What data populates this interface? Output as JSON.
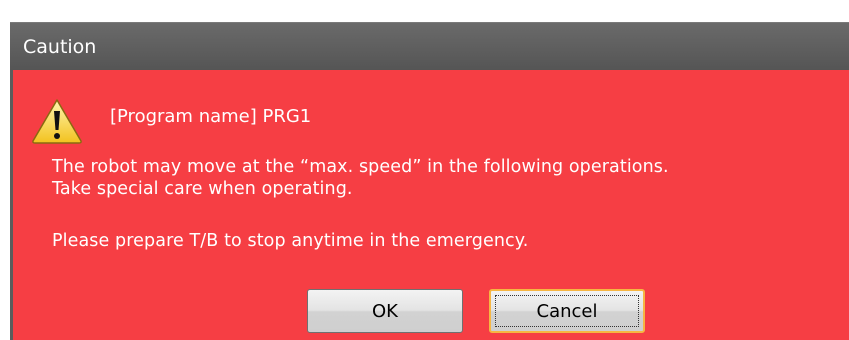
{
  "dialog": {
    "title": "Caution",
    "program_line": "[Program name] PRG1",
    "message_line_1": "The robot may move at the “max. speed” in the following operations.",
    "message_line_2": "Take special care when operating.",
    "message_line_3": "Please prepare T/B to stop anytime in the emergency.",
    "icon": "warning-triangle-icon"
  },
  "buttons": {
    "ok_label": "OK",
    "cancel_label": "Cancel"
  },
  "colors": {
    "body_background": "#f63e44",
    "title_bar": "#5c5c5c",
    "focus_outline": "#f6b642"
  }
}
